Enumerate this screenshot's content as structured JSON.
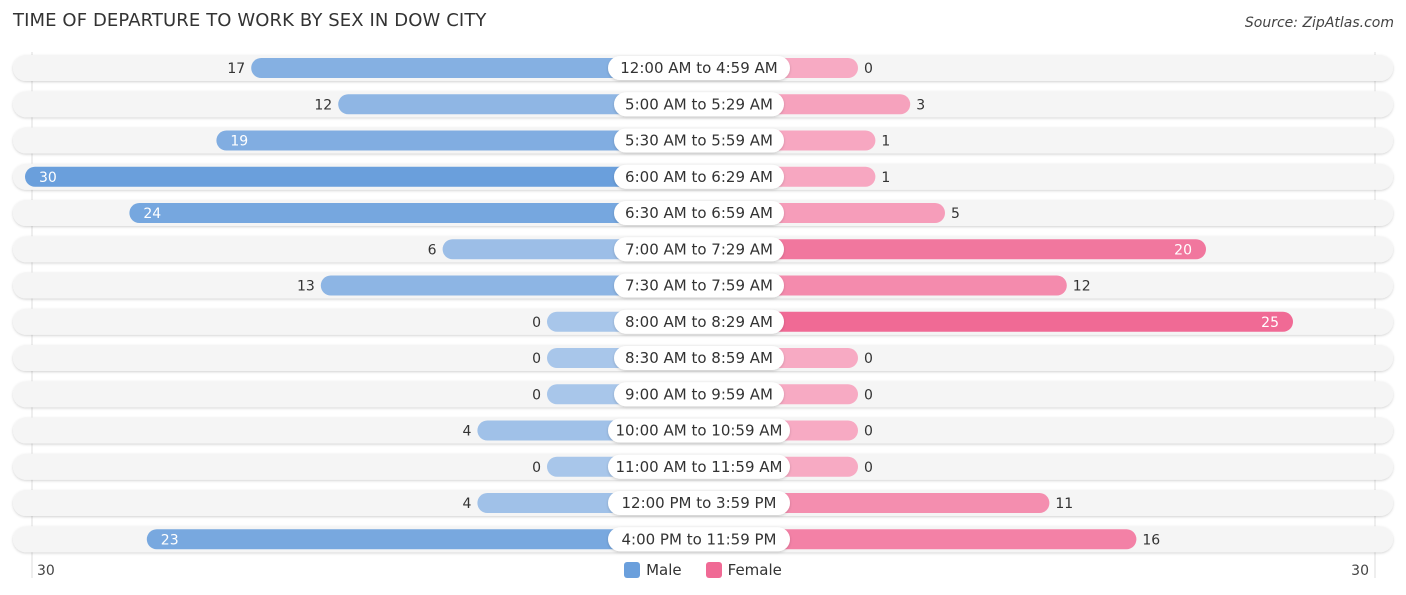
{
  "title": "TIME OF DEPARTURE TO WORK BY SEX IN DOW CITY",
  "source": "Source: ZipAtlas.com",
  "colors": {
    "male": "#6a9fdc",
    "male_light": "#a8c6ea",
    "female": "#f06a95",
    "female_light": "#f7aac3"
  },
  "chart_data": {
    "type": "bar",
    "orientation": "horizontal-diverging",
    "title": "TIME OF DEPARTURE TO WORK BY SEX IN DOW CITY",
    "categories": [
      "12:00 AM to 4:59 AM",
      "5:00 AM to 5:29 AM",
      "5:30 AM to 5:59 AM",
      "6:00 AM to 6:29 AM",
      "6:30 AM to 6:59 AM",
      "7:00 AM to 7:29 AM",
      "7:30 AM to 7:59 AM",
      "8:00 AM to 8:29 AM",
      "8:30 AM to 8:59 AM",
      "9:00 AM to 9:59 AM",
      "10:00 AM to 10:59 AM",
      "11:00 AM to 11:59 AM",
      "12:00 PM to 3:59 PM",
      "4:00 PM to 11:59 PM"
    ],
    "series": [
      {
        "name": "Male",
        "values": [
          17,
          12,
          19,
          30,
          24,
          6,
          13,
          0,
          0,
          0,
          4,
          0,
          4,
          23
        ]
      },
      {
        "name": "Female",
        "values": [
          0,
          3,
          1,
          1,
          5,
          20,
          12,
          25,
          0,
          0,
          0,
          0,
          11,
          16
        ]
      }
    ],
    "axis_left_label": "30",
    "axis_right_label": "30",
    "xlim": [
      30,
      30
    ],
    "legend": {
      "position": "bottom-center",
      "entries": [
        "Male",
        "Female"
      ]
    }
  }
}
